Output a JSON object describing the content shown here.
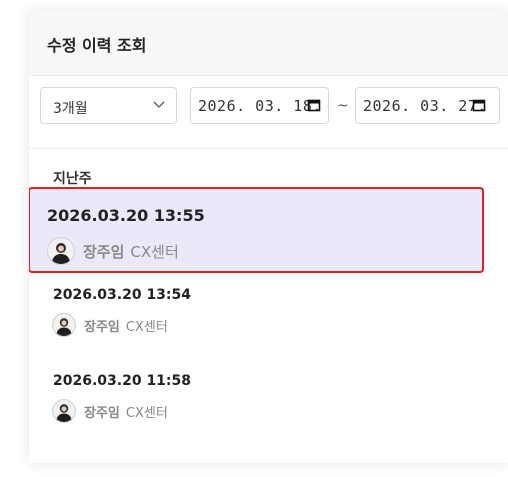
{
  "panel": {
    "title": "수정 이력 조회"
  },
  "filters": {
    "period_selected": "3개월",
    "start_date": "2026. 03. 18.",
    "end_date": "2026. 03. 27.",
    "range_separator": "~"
  },
  "history": {
    "group_label": "지난주",
    "entries": [
      {
        "time": "2026.03.20 13:55",
        "author": "장주임",
        "department": "CX센터",
        "selected": true
      },
      {
        "time": "2026.03.20 13:54",
        "author": "장주임",
        "department": "CX센터",
        "selected": false
      },
      {
        "time": "2026.03.20 11:58",
        "author": "장주임",
        "department": "CX센터",
        "selected": false
      }
    ]
  },
  "icons": {
    "select": "chevron-down-icon",
    "date": "calendar-icon",
    "avatar": "user-avatar-icon"
  },
  "colors": {
    "selected_background": "#ebe9f9",
    "selected_border": "#e02020",
    "header_background": "#f7f7f8",
    "muted_text": "#888888"
  }
}
